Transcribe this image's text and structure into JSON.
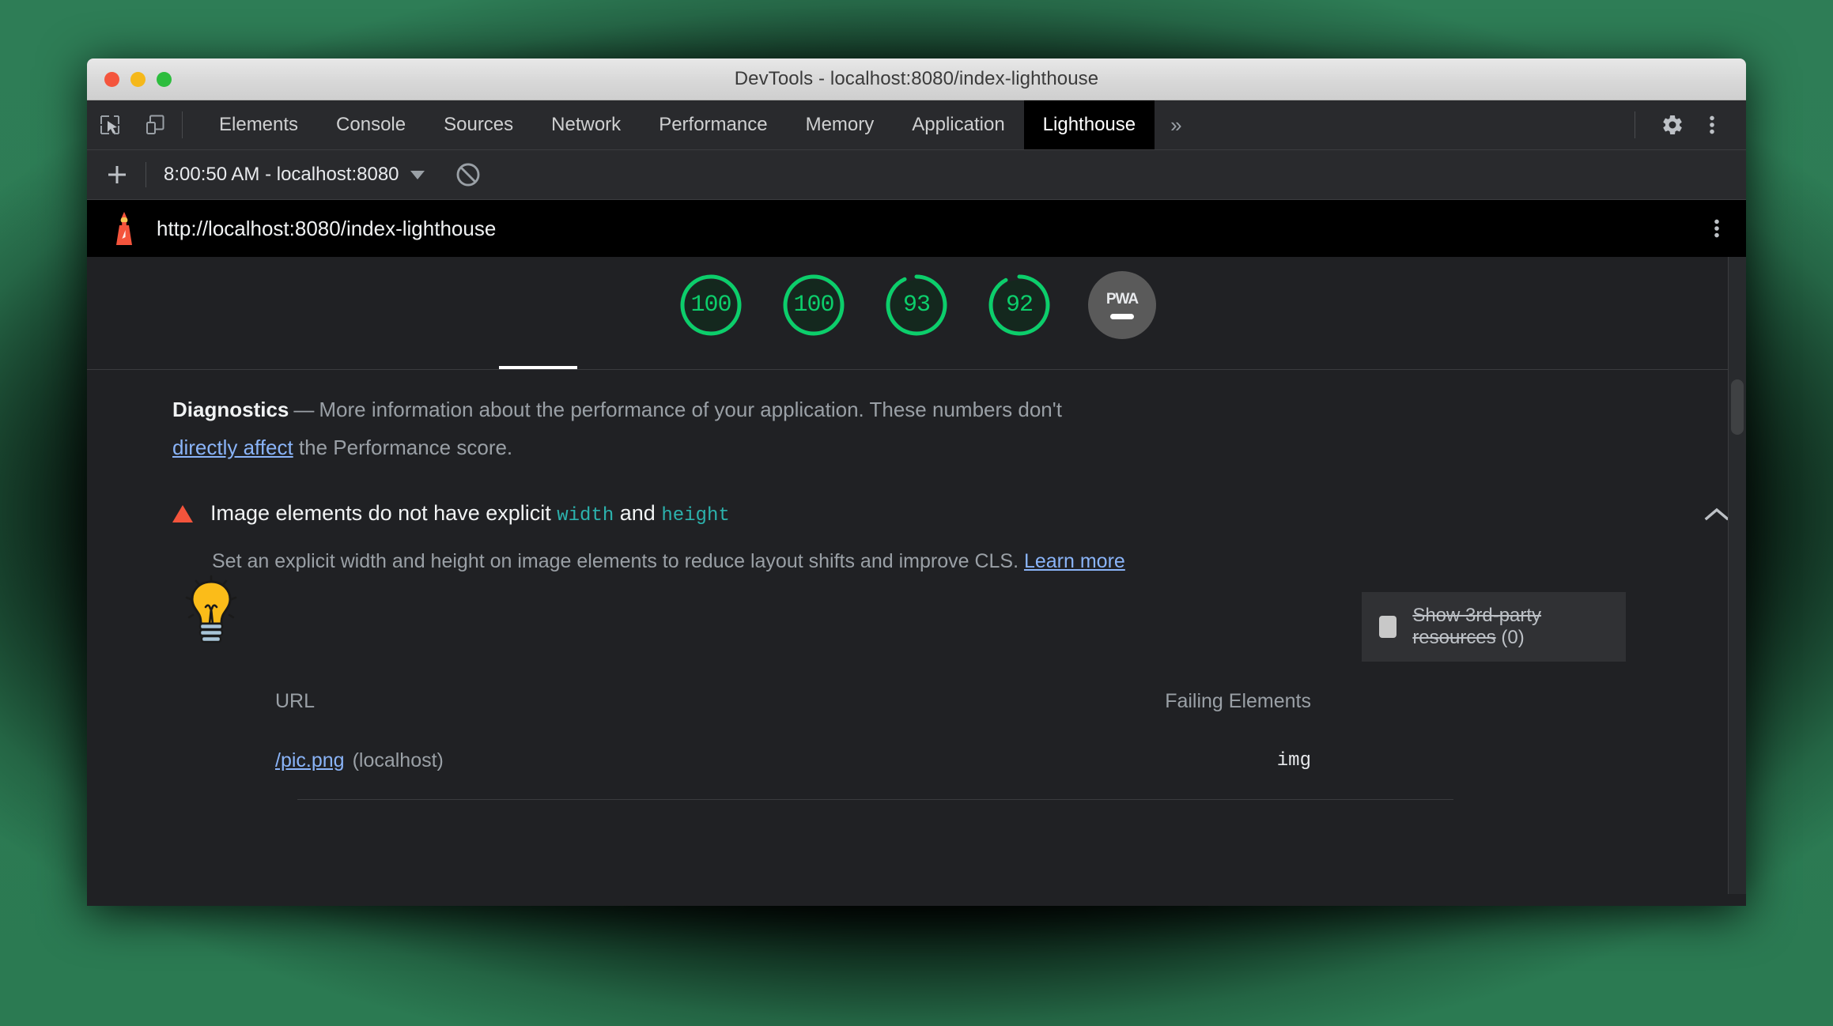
{
  "window": {
    "title": "DevTools - localhost:8080/index-lighthouse",
    "traffic_lights": [
      "close",
      "minimize",
      "zoom"
    ]
  },
  "tabstrip": {
    "inspect_icon": "inspect-element-icon",
    "device_icon": "device-toolbar-icon",
    "tabs": [
      {
        "label": "Elements",
        "active": false
      },
      {
        "label": "Console",
        "active": false
      },
      {
        "label": "Sources",
        "active": false
      },
      {
        "label": "Network",
        "active": false
      },
      {
        "label": "Performance",
        "active": false
      },
      {
        "label": "Memory",
        "active": false
      },
      {
        "label": "Application",
        "active": false
      },
      {
        "label": "Lighthouse",
        "active": true
      }
    ],
    "more_tabs": "»",
    "settings_icon": "gear-icon",
    "menu_icon": "kebab-menu-icon"
  },
  "subbar": {
    "add_icon": "plus-icon",
    "run_label": "8:00:50 AM - localhost:8080",
    "dropdown_icon": "chevron-down-icon",
    "clear_icon": "clear-prohibited-icon"
  },
  "report_header": {
    "logo": "lighthouse-logo-icon",
    "url": "http://localhost:8080/index-lighthouse",
    "menu_icon": "kebab-menu-icon"
  },
  "gauges": [
    {
      "name": "performance",
      "score": "100",
      "percent": 100,
      "active": true
    },
    {
      "name": "accessibility",
      "score": "100",
      "percent": 100,
      "active": false
    },
    {
      "name": "best-practices",
      "score": "93",
      "percent": 93,
      "active": false
    },
    {
      "name": "seo",
      "score": "92",
      "percent": 92,
      "active": false
    }
  ],
  "pwa": {
    "label": "PWA",
    "state": "dash"
  },
  "diagnostics": {
    "heading": "Diagnostics",
    "dash": "—",
    "text_before_link": "More information about the performance of your application. These numbers don't ",
    "link_text": "directly affect",
    "text_after_link": " the Performance score."
  },
  "audit": {
    "warning_icon": "warning-triangle-icon",
    "title_part1": "Image elements do not have explicit ",
    "title_code1": "width",
    "title_part2": " and ",
    "title_code2": "height",
    "collapse_icon": "chevron-up-icon",
    "description": "Set an explicit width and height on image elements to reduce layout shifts and improve CLS. ",
    "learn_more": "Learn more",
    "third_party": {
      "checkbox_state": "unchecked",
      "label_struck": "Show 3rd-party resources",
      "count": "(0)"
    },
    "table": {
      "columns": [
        "URL",
        "Failing Elements"
      ],
      "rows": [
        {
          "url": "/pic.png",
          "host": "(localhost)",
          "failing_element": "img"
        }
      ]
    }
  },
  "cursor": {
    "icon": "lightbulb-cursor-icon"
  },
  "scrollbar": {
    "orientation": "vertical"
  },
  "colors": {
    "score_green": "#0cce6b",
    "link_blue": "#8ab4f8",
    "code_teal": "#2cb2ad",
    "warning_orange": "#f4543c",
    "panel_bg": "#202124",
    "toolbar_bg": "#292a2d"
  }
}
